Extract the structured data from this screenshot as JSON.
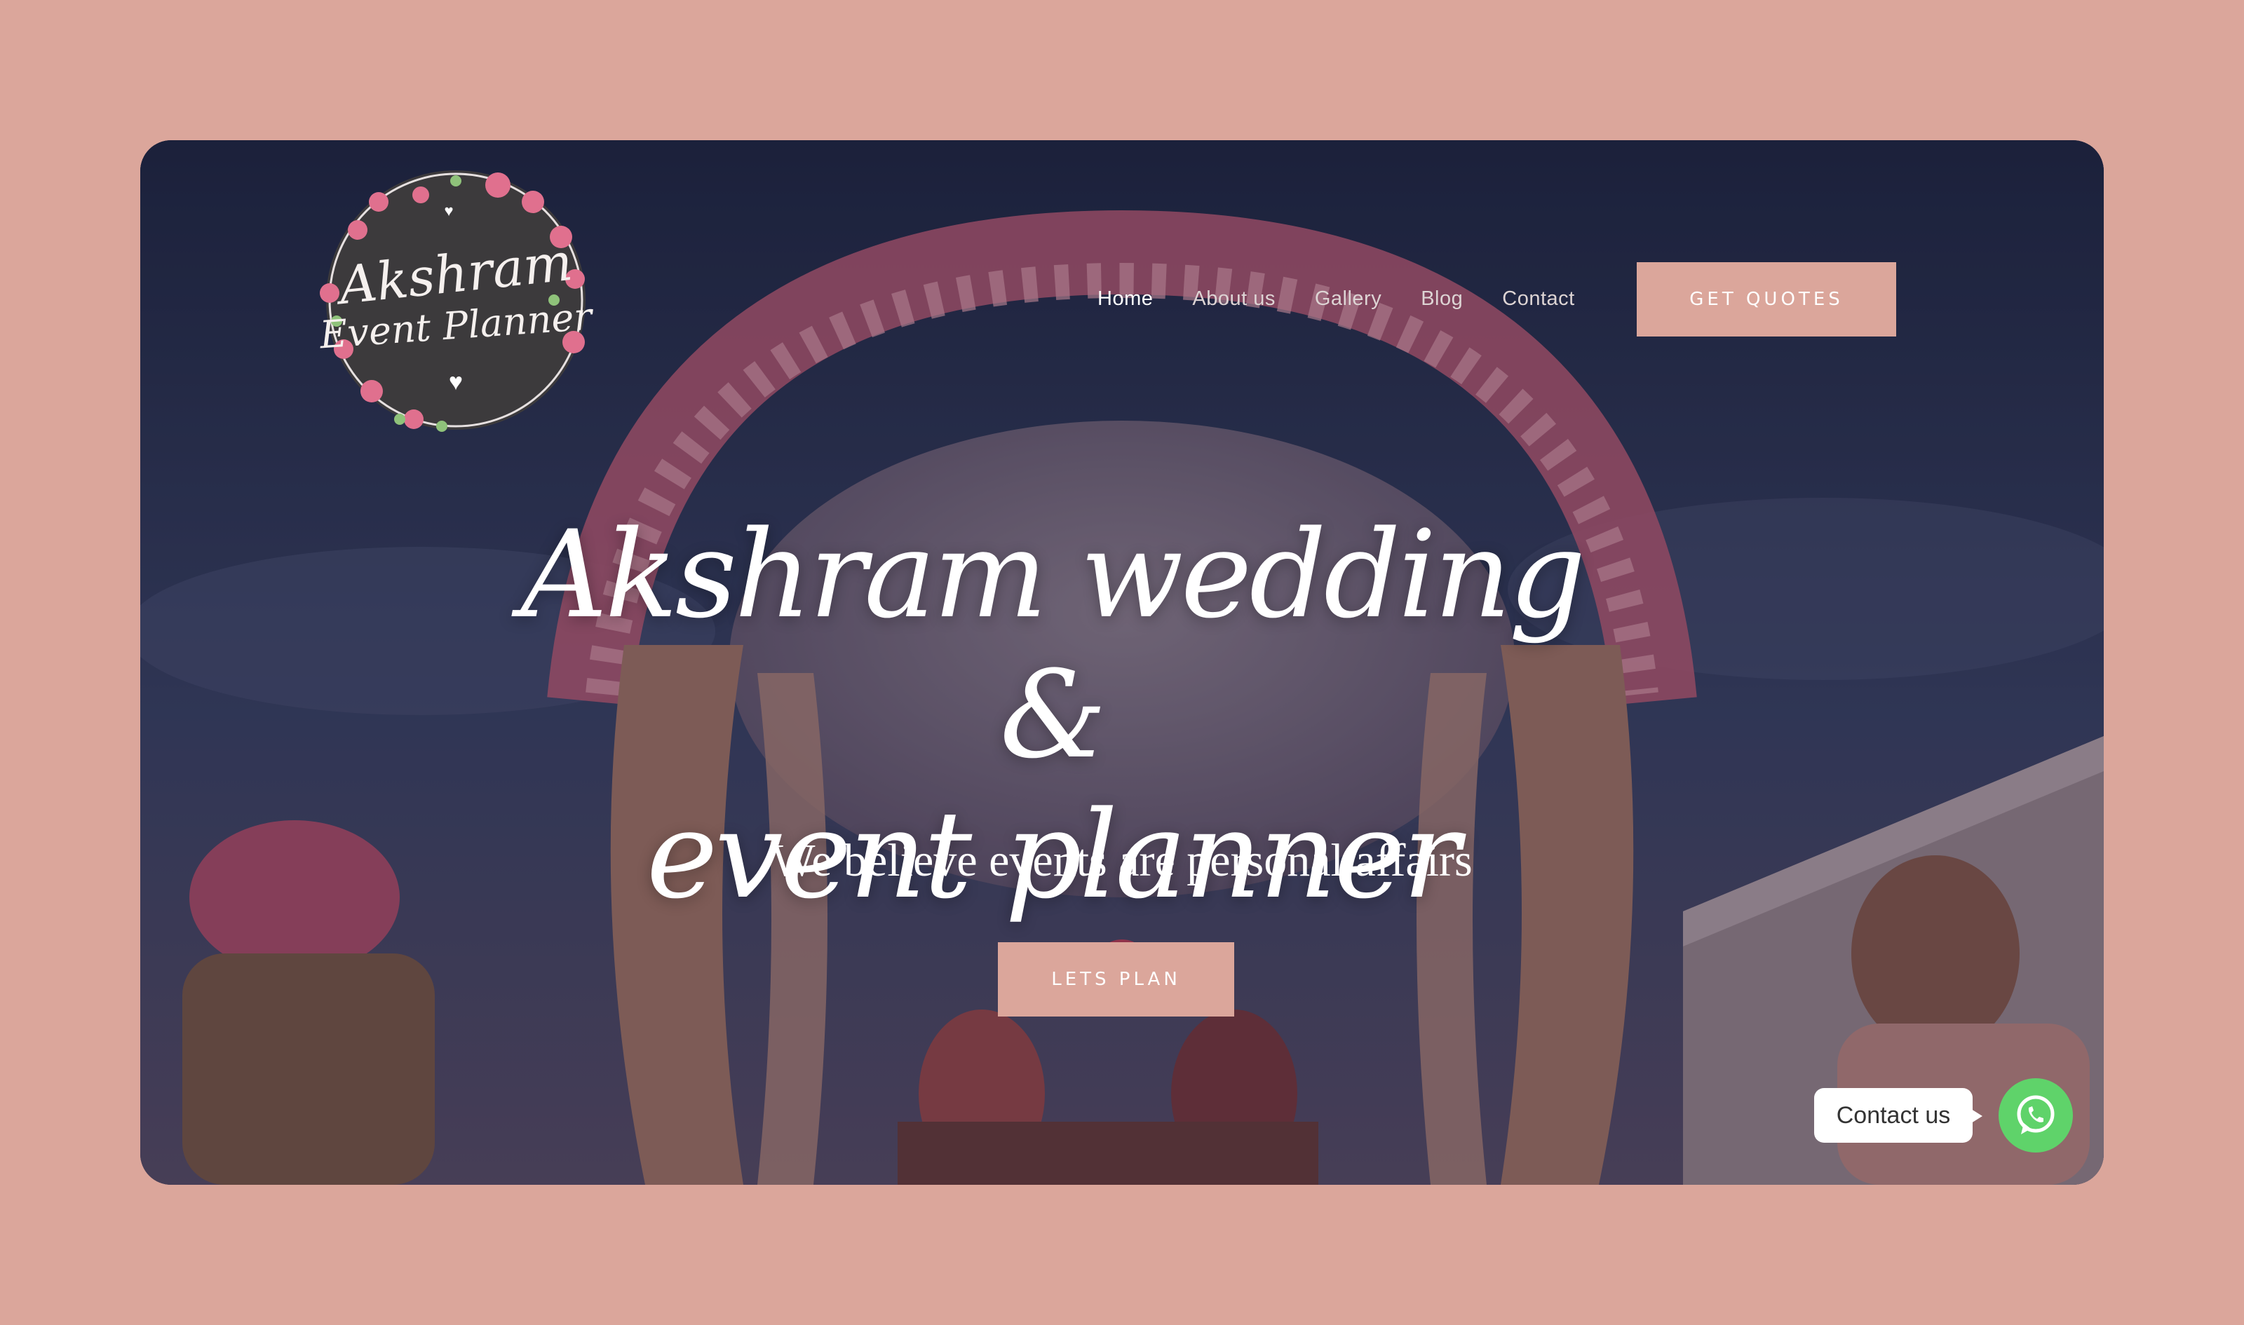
{
  "logo": {
    "line1": "Akshram",
    "line2": "Event Planner"
  },
  "nav": {
    "items": [
      {
        "label": "Home",
        "active": true
      },
      {
        "label": "About us",
        "active": false
      },
      {
        "label": "Gallery",
        "active": false
      },
      {
        "label": "Blog",
        "active": false
      },
      {
        "label": "Contact",
        "active": false
      }
    ],
    "cta_label": "GET QUOTES"
  },
  "hero": {
    "headline_line1": "Akshram wedding  &",
    "headline_line2": "event planner",
    "tagline": "We believe events are personal affairs",
    "cta_label": "LETS PLAN"
  },
  "whatsapp": {
    "label": "Contact us",
    "icon": "whatsapp-icon"
  },
  "colors": {
    "accent": "#dba69b",
    "page_background": "#dba69b",
    "whatsapp": "#5fd36a"
  }
}
